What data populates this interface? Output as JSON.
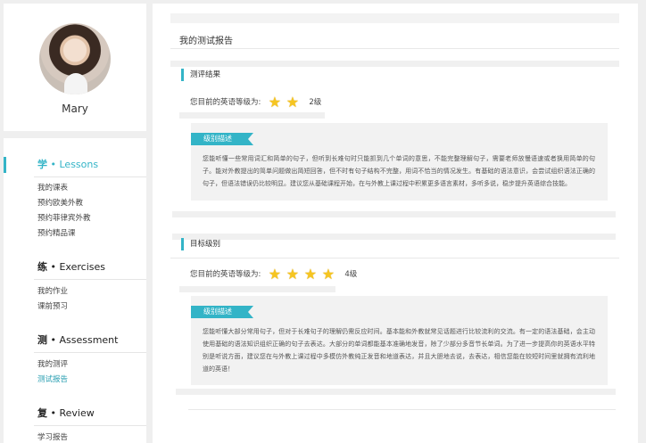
{
  "profile": {
    "name": "Mary"
  },
  "nav": {
    "lessons": {
      "zh": "学",
      "en": "• Lessons",
      "items": [
        "我的课表",
        "预约欧美外教",
        "预约菲律宾外教",
        "预约精品课"
      ]
    },
    "exercises": {
      "zh": "练",
      "en": "• Exercises",
      "items": [
        "我的作业",
        "课前预习"
      ]
    },
    "assessment": {
      "zh": "测",
      "en": "• Assessment",
      "items": [
        "我的测评",
        "测试报告"
      ]
    },
    "review": {
      "zh": "复",
      "en": "• Review",
      "items": [
        "学习报告"
      ]
    }
  },
  "report": {
    "page_title": "我的测试报告",
    "result": {
      "heading": "测评结果",
      "level_label": "您目前的英语等级为:",
      "stars": 2,
      "level_text": "2级",
      "ribbon": "级别描述",
      "description": "您能听懂一些常用词汇和简单的句子，但听到长难句时只能抓到几个单词的意思，不能完整理解句子，需要老师放慢语速或者换用简单的句子。能对外教提出的简单问题做出简短回答，但不时有句子结构不完整，用词不恰当的情况发生。有基础的语法意识，会尝试组织语法正确的句子，但语法错误仍比较明显。建议您从基础课程开始，在与外教上课过程中积累更多语言素材，多听多说，稳步提升英语综合技能。"
    },
    "target": {
      "heading": "目标级别",
      "level_label": "您目前的英语等级为:",
      "stars": 4,
      "level_text": "4级",
      "ribbon": "级别描述",
      "description": "您能听懂大部分常用句子，但对于长难句子的理解仍需反应时间。基本能和外教就常见话题进行比较流利的交流。有一定的语法基础，会主动使用基础的语法知识组织正确的句子去表达。大部分的单词都能基本准确地发音，除了少部分多音节长单词。为了进一步提高你的英语水平特别是听说方面，建议您在与外教上课过程中多模仿外教纯正发音和地道表达，并且大胆地去说，去表达，相信您能在较短时间里就拥有流利地道的英语！"
    }
  },
  "colors": {
    "accent": "#33b4c7",
    "star": "#f6c520"
  }
}
